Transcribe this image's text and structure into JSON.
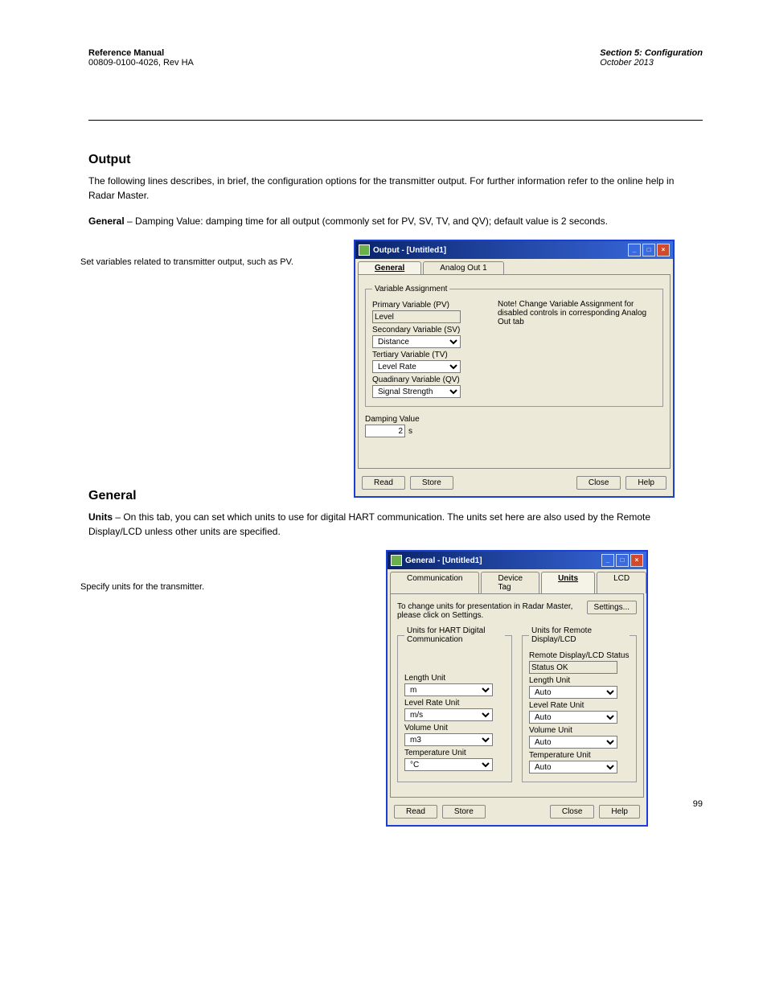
{
  "header": {
    "manual_left": "Reference Manual",
    "manual_code": "00809-0100-4026, Rev HA",
    "section_right_title": "Section 5: Configuration",
    "section_right_date": "October 2013"
  },
  "output_section": {
    "title": "Output",
    "p1": "The following lines describes, in brief, the configuration options for the transmitter output. For further information refer to the online help in Radar Master.",
    "p2_strong": "General",
    "p2_body": "Damping Value: damping time for all output (commonly set for PV, SV, TV, and QV); default value is 2 seconds.",
    "callout": "Set variables related to transmitter output, such as PV."
  },
  "win_output": {
    "title": "Output - [Untitled1]",
    "tabs": [
      "General",
      "Analog Out 1"
    ],
    "fieldset": "Variable Assignment",
    "pv_label": "Primary Variable (PV)",
    "pv_value": "Level",
    "sv_label": "Secondary Variable (SV)",
    "sv_value": "Distance",
    "tv_label": "Tertiary Variable (TV)",
    "tv_value": "Level Rate",
    "qv_label": "Quadinary Variable (QV)",
    "qv_value": "Signal Strength",
    "note": "Note! Change Variable Assignment for disabled controls in corresponding Analog Out tab",
    "damping_label": "Damping Value",
    "damping_value": "2",
    "damping_unit": "s",
    "btn_read": "Read",
    "btn_store": "Store",
    "btn_close": "Close",
    "btn_help": "Help"
  },
  "general_section": {
    "title": "General",
    "p1_strong": "Units",
    "p1_body": "On this tab, you can set which units to use for digital HART communication. The units set here are also used by the Remote Display/LCD unless other units are specified.",
    "callout": "Specify units for the transmitter."
  },
  "win_general": {
    "title": "General - [Untitled1]",
    "tabs": [
      "Communication",
      "Device Tag",
      "Units",
      "LCD"
    ],
    "instruction": "To change units for presentation in Radar Master, please click on Settings.",
    "btn_settings": "Settings...",
    "left_legend": "Units for HART Digital Communication",
    "right_legend": "Units for Remote Display/LCD",
    "status_label": "Remote Display/LCD Status",
    "status_value": "Status OK",
    "length_label": "Length Unit",
    "length_left": "m",
    "length_right": "Auto",
    "rate_label": "Level Rate Unit",
    "rate_left": "m/s",
    "rate_right": "Auto",
    "volume_label": "Volume Unit",
    "volume_left": "m3",
    "volume_right": "Auto",
    "temp_label": "Temperature Unit",
    "temp_left": "°C",
    "temp_right": "Auto",
    "btn_read": "Read",
    "btn_store": "Store",
    "btn_close": "Close",
    "btn_help": "Help"
  },
  "footer_page": "99"
}
